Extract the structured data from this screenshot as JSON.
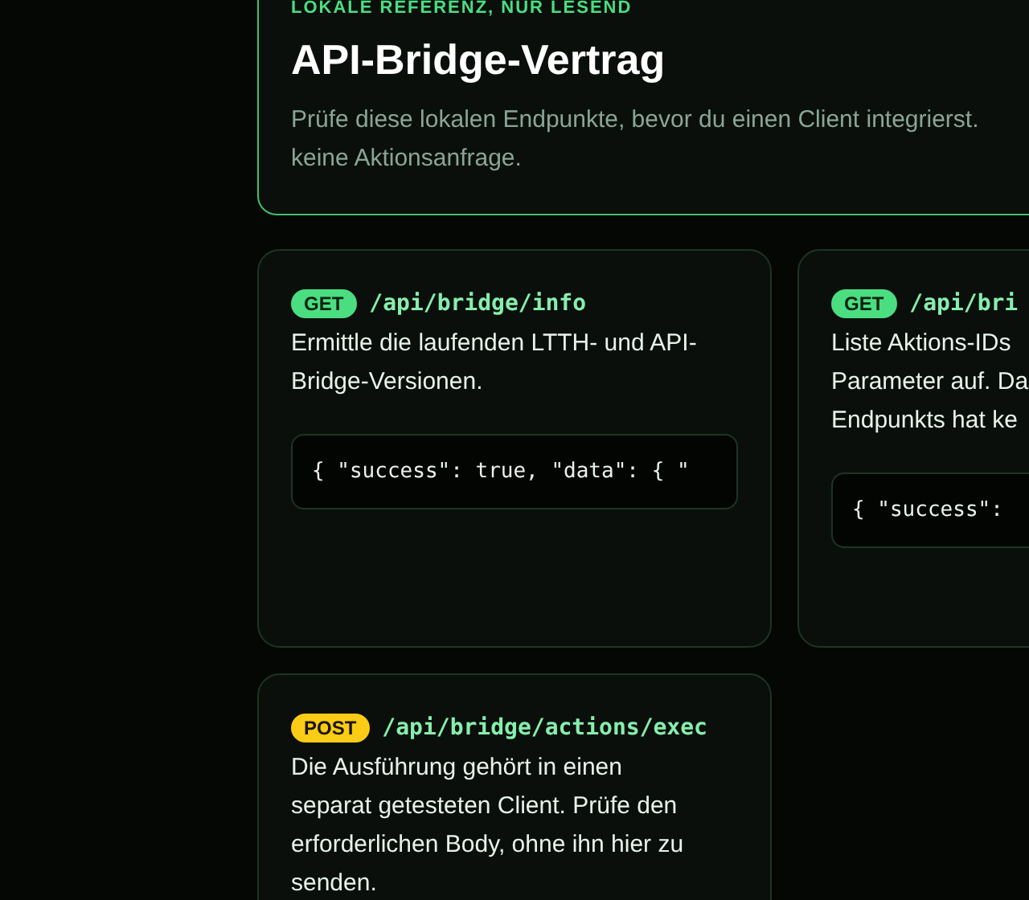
{
  "header": {
    "eyebrow": "LOKALE REFERENZ, NUR LESEND",
    "title": "API-Bridge-Vertrag",
    "subtitle_lines": [
      "Prüfe diese lokalen Endpunkte, bevor du einen Client integrierst.",
      "keine Aktionsanfrage."
    ]
  },
  "endpoints": [
    {
      "kind": "get",
      "method": "GET",
      "path": "/api/bridge/info",
      "description_lines": [
        "Ermittle die laufenden LTTH- und API-",
        "Bridge-Versionen."
      ],
      "example": "{ \"success\": true, \"data\": { \""
    },
    {
      "kind": "get",
      "method": "GET",
      "path": "/api/bri",
      "description_lines": [
        "Liste Aktions-IDs",
        "Parameter auf. Da",
        "Endpunkts hat ke"
      ],
      "example": "{ \"success\":"
    },
    {
      "kind": "post",
      "method": "POST",
      "path": "/api/bridge/actions/exec",
      "description_lines": [
        "Die Ausführung gehört in einen",
        "separat getesteten Client. Prüfe den",
        "erforderlichen Body, ohne ihn hier zu",
        "senden."
      ]
    }
  ]
}
